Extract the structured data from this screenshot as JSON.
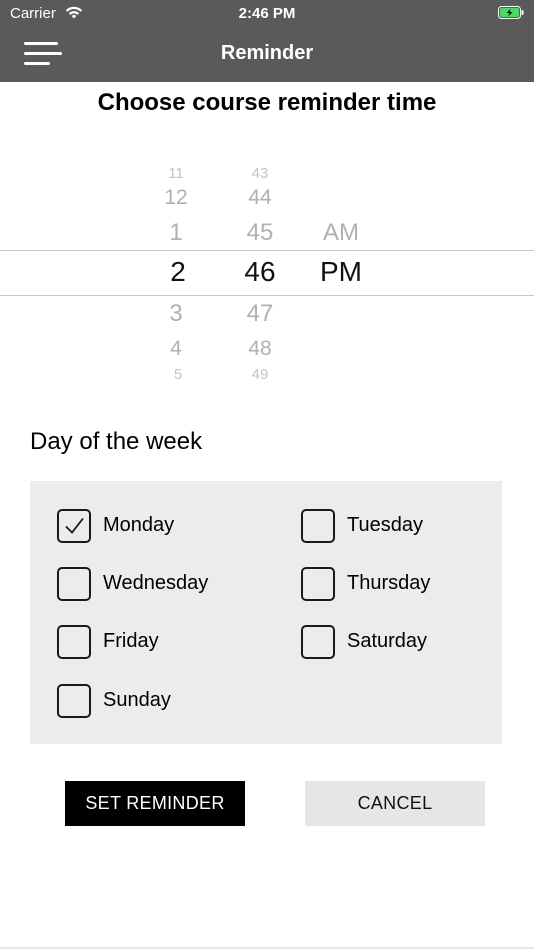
{
  "status_bar": {
    "carrier": "Carrier",
    "time": "2:46 PM",
    "background": "#5a5a5a"
  },
  "nav": {
    "title": "Reminder"
  },
  "heading": "Choose course reminder time",
  "picker": {
    "hour": {
      "above": [
        "11",
        "12",
        "1"
      ],
      "selected": "2",
      "below": [
        "3",
        "4",
        "5"
      ]
    },
    "minute": {
      "above": [
        "43",
        "44",
        "45"
      ],
      "selected": "46",
      "below": [
        "47",
        "48",
        "49"
      ]
    },
    "ampm": {
      "above": "AM",
      "selected": "PM"
    }
  },
  "days_section": {
    "title": "Day of the week",
    "days": [
      {
        "label": "Monday",
        "checked": true
      },
      {
        "label": "Tuesday",
        "checked": false
      },
      {
        "label": "Wednesday",
        "checked": false
      },
      {
        "label": "Thursday",
        "checked": false
      },
      {
        "label": "Friday",
        "checked": false
      },
      {
        "label": "Saturday",
        "checked": false
      },
      {
        "label": "Sunday",
        "checked": false
      }
    ]
  },
  "buttons": {
    "set": "SET REMINDER",
    "cancel": "CANCEL"
  },
  "colors": {
    "nav_bg": "#5a5a5a",
    "panel_bg": "#ececec",
    "primary_btn": "#000000",
    "secondary_btn": "#e6e6e6"
  },
  "icons": [
    "wifi-icon",
    "battery-charging-icon",
    "menu-icon",
    "checkmark-icon"
  ]
}
